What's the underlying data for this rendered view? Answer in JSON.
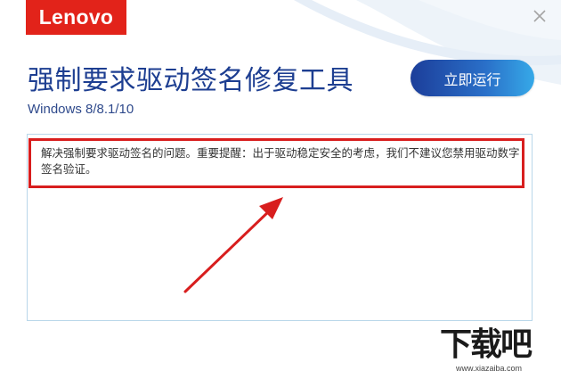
{
  "brand": {
    "logo_text": "Lenovo"
  },
  "window": {
    "close_label": "close"
  },
  "header": {
    "title": "强制要求驱动签名修复工具",
    "subtitle": "Windows 8/8.1/10"
  },
  "actions": {
    "run_label": "立即运行"
  },
  "description": {
    "text": "解决强制要求驱动签名的问题。重要提醒：出于驱动稳定安全的考虑，我们不建议您禁用驱动数字签名验证。"
  },
  "watermark": {
    "main": "下载吧",
    "url": "www.xiazaiba.com"
  },
  "colors": {
    "logo_red": "#e2231a",
    "title_blue": "#1d3e91",
    "button_start": "#1c3e9a",
    "button_end": "#36a9e8",
    "highlight_red": "#d81e1e",
    "panel_border": "#b9d7ea"
  }
}
